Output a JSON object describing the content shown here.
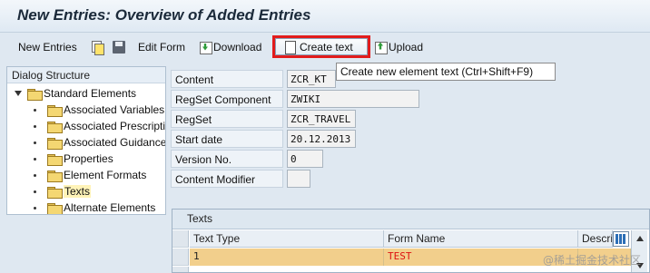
{
  "window": {
    "title": "New Entries: Overview of Added Entries"
  },
  "toolbar": {
    "new_entries": "New Entries",
    "copy_icon": "copy-icon",
    "save_icon": "save-icon",
    "edit_form": "Edit Form",
    "download": "Download",
    "create_text": "Create text",
    "upload": "Upload"
  },
  "tooltip": {
    "text": "Create new element text   (Ctrl+Shift+F9)"
  },
  "dialog_structure": {
    "header": "Dialog Structure",
    "root": "Standard Elements",
    "items": [
      "Associated Variables",
      "Associated Prescriptio",
      "Associated Guidance",
      "Properties",
      "Element Formats",
      "Texts",
      "Alternate Elements"
    ],
    "selected": "Texts"
  },
  "form": {
    "fields": [
      {
        "label": "Content",
        "value": "ZCR_KT"
      },
      {
        "label": "RegSet Component",
        "value": "ZWIKI"
      },
      {
        "label": "RegSet",
        "value": "ZCR_TRAVEL"
      },
      {
        "label": "Start date",
        "value": "20.12.2013"
      },
      {
        "label": "Version No.",
        "value": "0"
      },
      {
        "label": "Content Modifier",
        "value": ""
      }
    ]
  },
  "texts_table": {
    "title": "Texts",
    "columns": [
      "Text Type",
      "Form Name",
      "Descri"
    ],
    "rows": [
      {
        "text_type": "1",
        "form_name": "TEST",
        "description": ""
      }
    ]
  },
  "watermark": "@稀土掘金技术社区",
  "colors": {
    "highlight_border": "#e21c1c",
    "row_highlight": "#f2cf8c",
    "value_red": "#dd1111"
  }
}
